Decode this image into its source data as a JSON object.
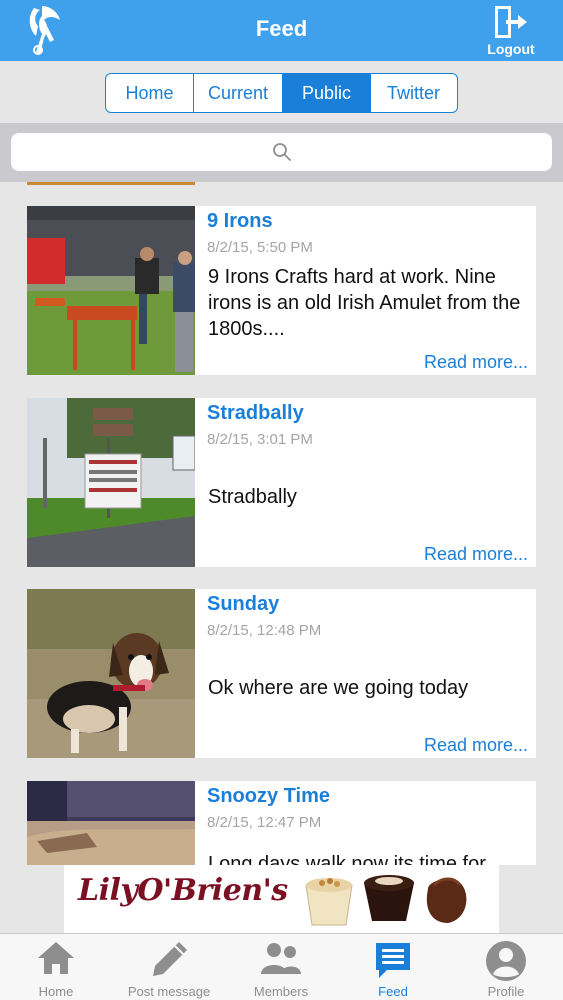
{
  "header": {
    "title": "Feed",
    "logout_label": "Logout",
    "color": "#3fa0ec"
  },
  "tabs": [
    {
      "label": "Home",
      "active": false
    },
    {
      "label": "Current",
      "active": false
    },
    {
      "label": "Public",
      "active": true
    },
    {
      "label": "Twitter",
      "active": false
    }
  ],
  "search": {
    "placeholder": "",
    "icon": "search-icon"
  },
  "feed": {
    "items": [
      {
        "title": "9 Irons",
        "date": "8/2/15, 5:50 PM",
        "body": "9 Irons Crafts hard at work. Nine irons is an old Irish Amulet from the 1800s....",
        "more": "Read more..."
      },
      {
        "title": "Stradbally",
        "date": "8/2/15, 3:01 PM",
        "body": "Stradbally",
        "more": "Read more..."
      },
      {
        "title": "Sunday",
        "date": "8/2/15, 12:48 PM",
        "body": "Ok where are we going today",
        "more": "Read more..."
      },
      {
        "title": "Snoozy Time",
        "date": "8/2/15, 12:47 PM",
        "body": "Long days walk now its time for",
        "more": ""
      }
    ]
  },
  "ad": {
    "brand": "LilyO'Brien's"
  },
  "bottom_nav": [
    {
      "label": "Home",
      "icon": "home-icon",
      "active": false
    },
    {
      "label": "Post message",
      "icon": "pencil-icon",
      "active": false
    },
    {
      "label": "Members",
      "icon": "members-icon",
      "active": false
    },
    {
      "label": "Feed",
      "icon": "feed-icon",
      "active": true
    },
    {
      "label": "Profile",
      "icon": "profile-icon",
      "active": false
    }
  ],
  "colors": {
    "accent": "#1a7fd9",
    "header": "#3fa0ec",
    "date": "#a5a5a5",
    "nav_inactive": "#8e8e8e"
  }
}
